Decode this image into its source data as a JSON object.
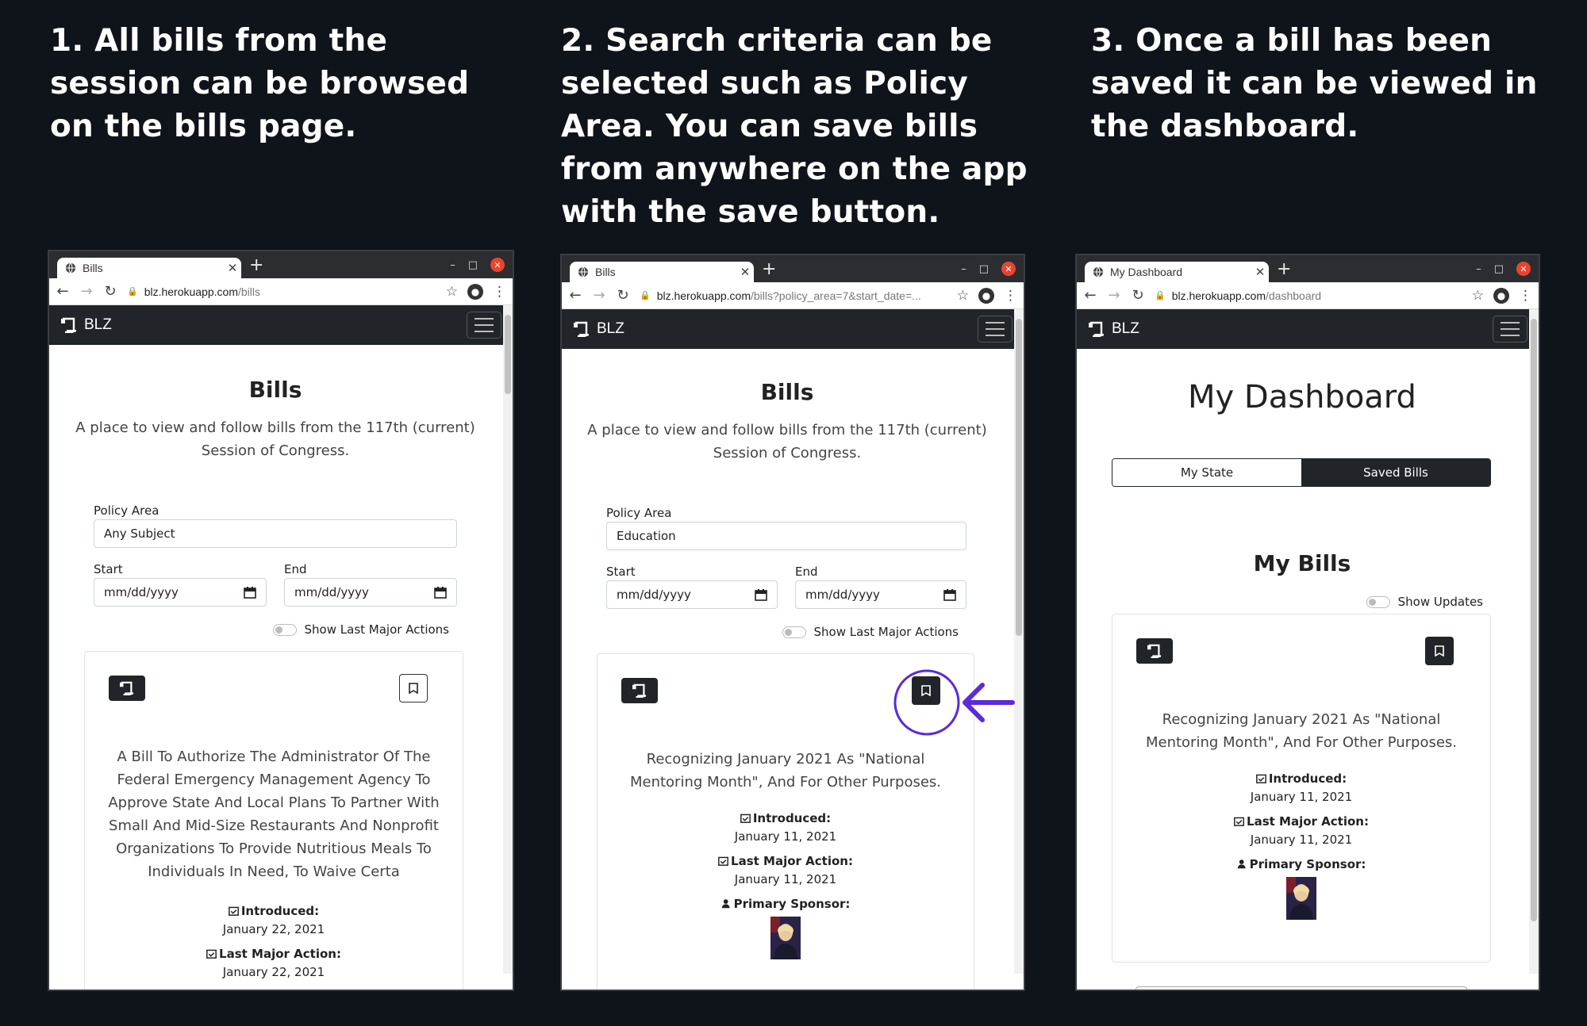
{
  "captions": [
    "1. All bills from the session can be browsed on the bills page.",
    "2. Search criteria can be selected such as Policy Area. You can save bills from anywhere on the app with the save button.",
    "3. Once a bill has been saved it can be viewed in the dashboard."
  ],
  "colors": {
    "background": "#0f131a",
    "navbar": "#212529",
    "highlight": "#5b2bd9",
    "close": "#e8452c"
  },
  "browser1": {
    "tab_title": "Bills",
    "url_host": "blz.herokuapp.com",
    "url_path": "/bills",
    "brand": "BLZ",
    "page_title": "Bills",
    "subtitle_line1": "A place to view and follow bills from the 117th (current)",
    "subtitle_line2": "Session of Congress.",
    "policy_label": "Policy Area",
    "policy_value": "Any Subject",
    "start_label": "Start",
    "end_label": "End",
    "start_value": "mm/dd/yyyy",
    "end_value": "mm/dd/yyyy",
    "toggle_label": "Show Last Major Actions",
    "bill": {
      "lines": [
        "A Bill To Authorize The Administrator Of The",
        "Federal Emergency Management Agency To",
        "Approve State And Local Plans To Partner With",
        "Small And Mid-Size Restaurants And Nonprofit",
        "Organizations To Provide Nutritious Meals To",
        "Individuals In Need, To Waive Certa"
      ],
      "introduced_label": "Introduced:",
      "introduced_date": "January 22, 2021",
      "last_action_label": "Last Major Action:",
      "last_action_date": "January 22, 2021"
    }
  },
  "browser2": {
    "tab_title": "Bills",
    "url_host": "blz.herokuapp.com",
    "url_path": "/bills?policy_area=7&start_date=...",
    "brand": "BLZ",
    "page_title": "Bills",
    "subtitle_line1": "A place to view and follow bills from the 117th (current)",
    "subtitle_line2": "Session of Congress.",
    "policy_label": "Policy Area",
    "policy_value": "Education",
    "start_label": "Start",
    "end_label": "End",
    "start_value": "mm/dd/yyyy",
    "end_value": "mm/dd/yyyy",
    "toggle_label": "Show Last Major Actions",
    "bill": {
      "line1": "Recognizing January 2021 As \"National",
      "line2": "Mentoring Month\", And For Other Purposes.",
      "introduced_label": "Introduced:",
      "introduced_date": "January 11, 2021",
      "last_action_label": "Last Major Action:",
      "last_action_date": "January 11, 2021",
      "sponsor_label": "Primary Sponsor:"
    }
  },
  "browser3": {
    "tab_title": "My Dashboard",
    "url_host": "blz.herokuapp.com",
    "url_path": "/dashboard",
    "brand": "BLZ",
    "page_title": "My Dashboard",
    "seg_left": "My State",
    "seg_right": "Saved Bills",
    "section_title": "My Bills",
    "toggle_label": "Show Updates",
    "bill": {
      "line1": "Recognizing January 2021 As \"National",
      "line2": "Mentoring Month\", And For Other Purposes.",
      "introduced_label": "Introduced:",
      "introduced_date": "January 11, 2021",
      "last_action_label": "Last Major Action:",
      "last_action_date": "January 11, 2021",
      "sponsor_label": "Primary Sponsor:"
    }
  }
}
